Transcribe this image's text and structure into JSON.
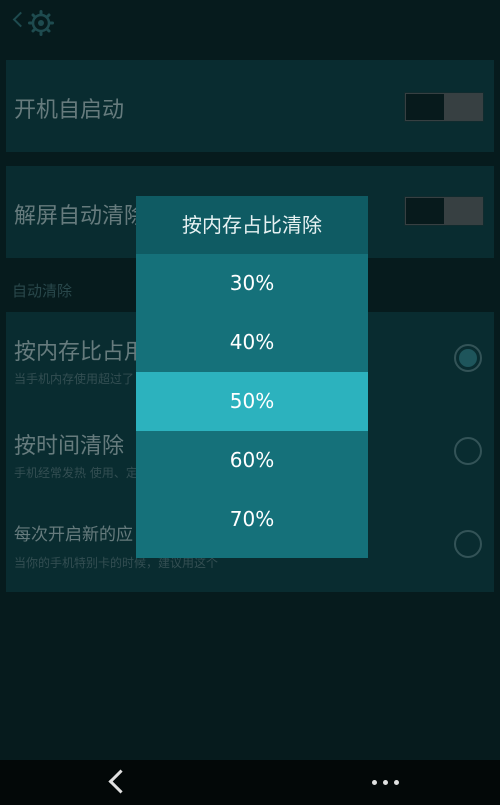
{
  "header": {
    "back_icon": "chevron-left-icon",
    "settings_icon": "gear-icon"
  },
  "settings": {
    "startup": {
      "title": "开机自启动",
      "enabled": false
    },
    "unlock_clean": {
      "title": "解屏自动清除",
      "enabled": false
    },
    "section_label": "自动清除",
    "options": [
      {
        "title": "按内存比占用",
        "subtitle": "当手机内存使用超过了",
        "selected": true
      },
      {
        "title": "按时间清除",
        "subtitle": "手机经常发热 使用、定",
        "selected": false
      },
      {
        "title": "每次开启新的应",
        "subtitle": "当你的手机特别卡的时候，建议用这个",
        "selected": false
      }
    ]
  },
  "dialog": {
    "title": "按内存占比清除",
    "options": [
      "30%",
      "40%",
      "50%",
      "60%",
      "70%"
    ],
    "selected": "50%"
  },
  "navbar": {
    "back_icon": "back-arrow-icon",
    "more_icon": "more-dots-icon"
  },
  "colors": {
    "accent": "#2cb2be",
    "dialog": "#15717a",
    "card": "#0e3f44"
  }
}
